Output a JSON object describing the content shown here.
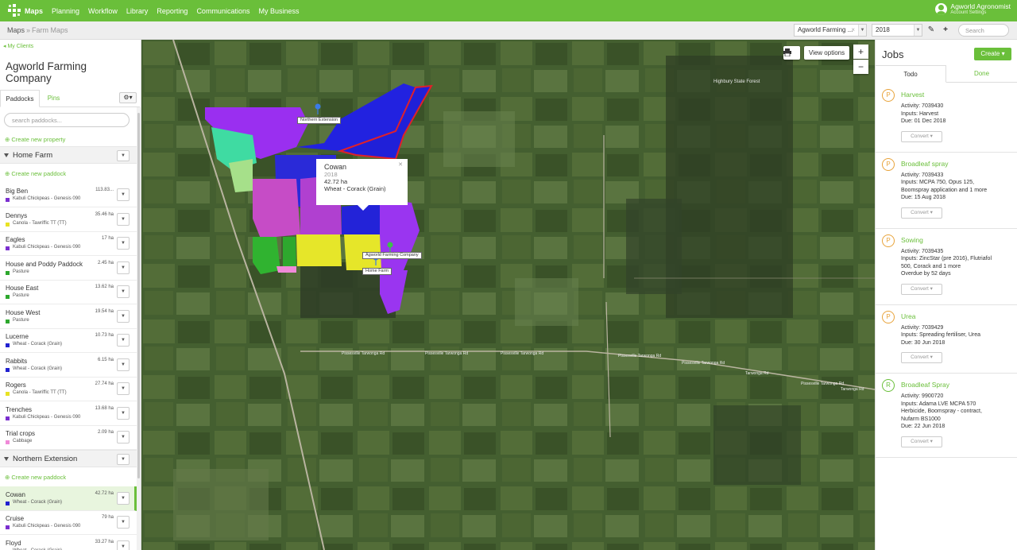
{
  "nav": {
    "items": [
      "Maps",
      "Planning",
      "Workflow",
      "Library",
      "Reporting",
      "Communications",
      "My Business"
    ],
    "user_name": "Agworld Agronomist",
    "user_sub": "Account Settings",
    "accent": "#6abf3a"
  },
  "subbar": {
    "breadcrumb_root": "Maps",
    "breadcrumb_current": "Farm Maps",
    "company_select": "Agworld Farming ...",
    "year_select": "2018",
    "search_placeholder": "Search"
  },
  "left": {
    "back_link": "My Clients",
    "company_title": "Agworld Farming Company",
    "tab_paddocks": "Paddocks",
    "tab_pins": "Pins",
    "search_placeholder": "search paddocks...",
    "create_property": "Create new property",
    "create_paddock": "Create new paddock",
    "farms": [
      {
        "name": "Home Farm",
        "paddocks": [
          {
            "name": "Big Ben",
            "area": "113.83...",
            "crop": "Kabuli Chickpeas - Genesis 090",
            "color": "#7b2fd0"
          },
          {
            "name": "Dennys",
            "area": "35.46 ha",
            "crop": "Canola - Tawriffic TT (TT)",
            "color": "#e8e324"
          },
          {
            "name": "Eagles",
            "area": "17 ha",
            "crop": "Kabuli Chickpeas - Genesis 090",
            "color": "#7b2fd0"
          },
          {
            "name": "House and Poddy Paddock",
            "area": "2.45 ha",
            "crop": "Pasture",
            "color": "#2ea82e"
          },
          {
            "name": "House East",
            "area": "13.62 ha",
            "crop": "Pasture",
            "color": "#2ea82e"
          },
          {
            "name": "House West",
            "area": "19.54 ha",
            "crop": "Pasture",
            "color": "#2ea82e"
          },
          {
            "name": "Lucerne",
            "area": "10.73 ha",
            "crop": "Wheat - Corack (Grain)",
            "color": "#2222d0"
          },
          {
            "name": "Rabbits",
            "area": "6.15 ha",
            "crop": "Wheat - Corack (Grain)",
            "color": "#2222d0"
          },
          {
            "name": "Rogers",
            "area": "27.74 ha",
            "crop": "Canola - Tawriffic TT (TT)",
            "color": "#e8e324"
          },
          {
            "name": "Trenches",
            "area": "13.68 ha",
            "crop": "Kabuli Chickpeas - Genesis 090",
            "color": "#7b2fd0"
          },
          {
            "name": "Trial crops",
            "area": "2.09 ha",
            "crop": "Cabbage",
            "color": "#f08ad8"
          }
        ]
      },
      {
        "name": "Northern Extension",
        "paddocks": [
          {
            "name": "Cowan",
            "area": "42.72 ha",
            "crop": "Wheat - Corack (Grain)",
            "color": "#2222d0"
          },
          {
            "name": "Cruise",
            "area": "79 ha",
            "crop": "Kabuli Chickpeas - Genesis 090",
            "color": "#7b2fd0"
          },
          {
            "name": "Floyd",
            "area": "33.27 ha",
            "crop": "Wheat - Corack (Grain)",
            "color": "#2222d0"
          }
        ]
      }
    ]
  },
  "map": {
    "print_icon": "printer-icon",
    "view_options": "View options",
    "zoom_in": "+",
    "zoom_out": "−",
    "label_northern": "Northern Extension",
    "label_company": "Agworld Farming Company",
    "label_home": "Home Farm",
    "forest_label": "Highbury State Forest",
    "roads": [
      "Pissesville Tarwonga Rd",
      "Pissesville Tarwonga Rd",
      "Pissesville Tarwonga Rd",
      "Pissesville Tarwonga Rd",
      "Pissesville Tarwonga Rd",
      "Tarwonga Rd",
      "Pissesville Tarwonga Rd",
      "Tarwonga Rd"
    ],
    "popup": {
      "title": "Cowan",
      "year": "2018",
      "area": "42.72 ha",
      "crop": "Wheat - Corack (Grain)"
    }
  },
  "jobs": {
    "title": "Jobs",
    "create": "Create",
    "tab_todo": "Todo",
    "tab_done": "Done",
    "convert": "Convert",
    "items": [
      {
        "badge": "P",
        "title": "Harvest",
        "lines": [
          "Activity: 7039430",
          "Inputs: Harvest",
          "Due: 01 Dec 2018"
        ],
        "color": "#e8a33a"
      },
      {
        "badge": "P",
        "title": "Broadleaf spray",
        "lines": [
          "Activity: 7039433",
          "Inputs: MCPA 750, Opus 125,",
          "Boomspray application and 1 more",
          "Due: 15 Aug 2018"
        ],
        "color": "#e8a33a"
      },
      {
        "badge": "P",
        "title": "Sowing",
        "lines": [
          "Activity: 7039435",
          "Inputs: ZincStar (pre 2016), Flutriafol",
          "500, Corack and 1 more",
          "Overdue by 52 days"
        ],
        "color": "#e8a33a"
      },
      {
        "badge": "P",
        "title": "Urea",
        "lines": [
          "Activity: 7039429",
          "Inputs: Spreading fertiliser, Urea",
          "Due: 30 Jun 2018"
        ],
        "color": "#e8a33a"
      },
      {
        "badge": "R",
        "title": "Broadleaf Spray",
        "lines": [
          "Activity: 9900720",
          "Inputs: Adama LVE MCPA 570",
          "Herbicide, Boomspray - contract,",
          "Nufarm BS1000",
          "Due: 22 Jun 2018"
        ],
        "color": "#6abf3a"
      }
    ]
  }
}
